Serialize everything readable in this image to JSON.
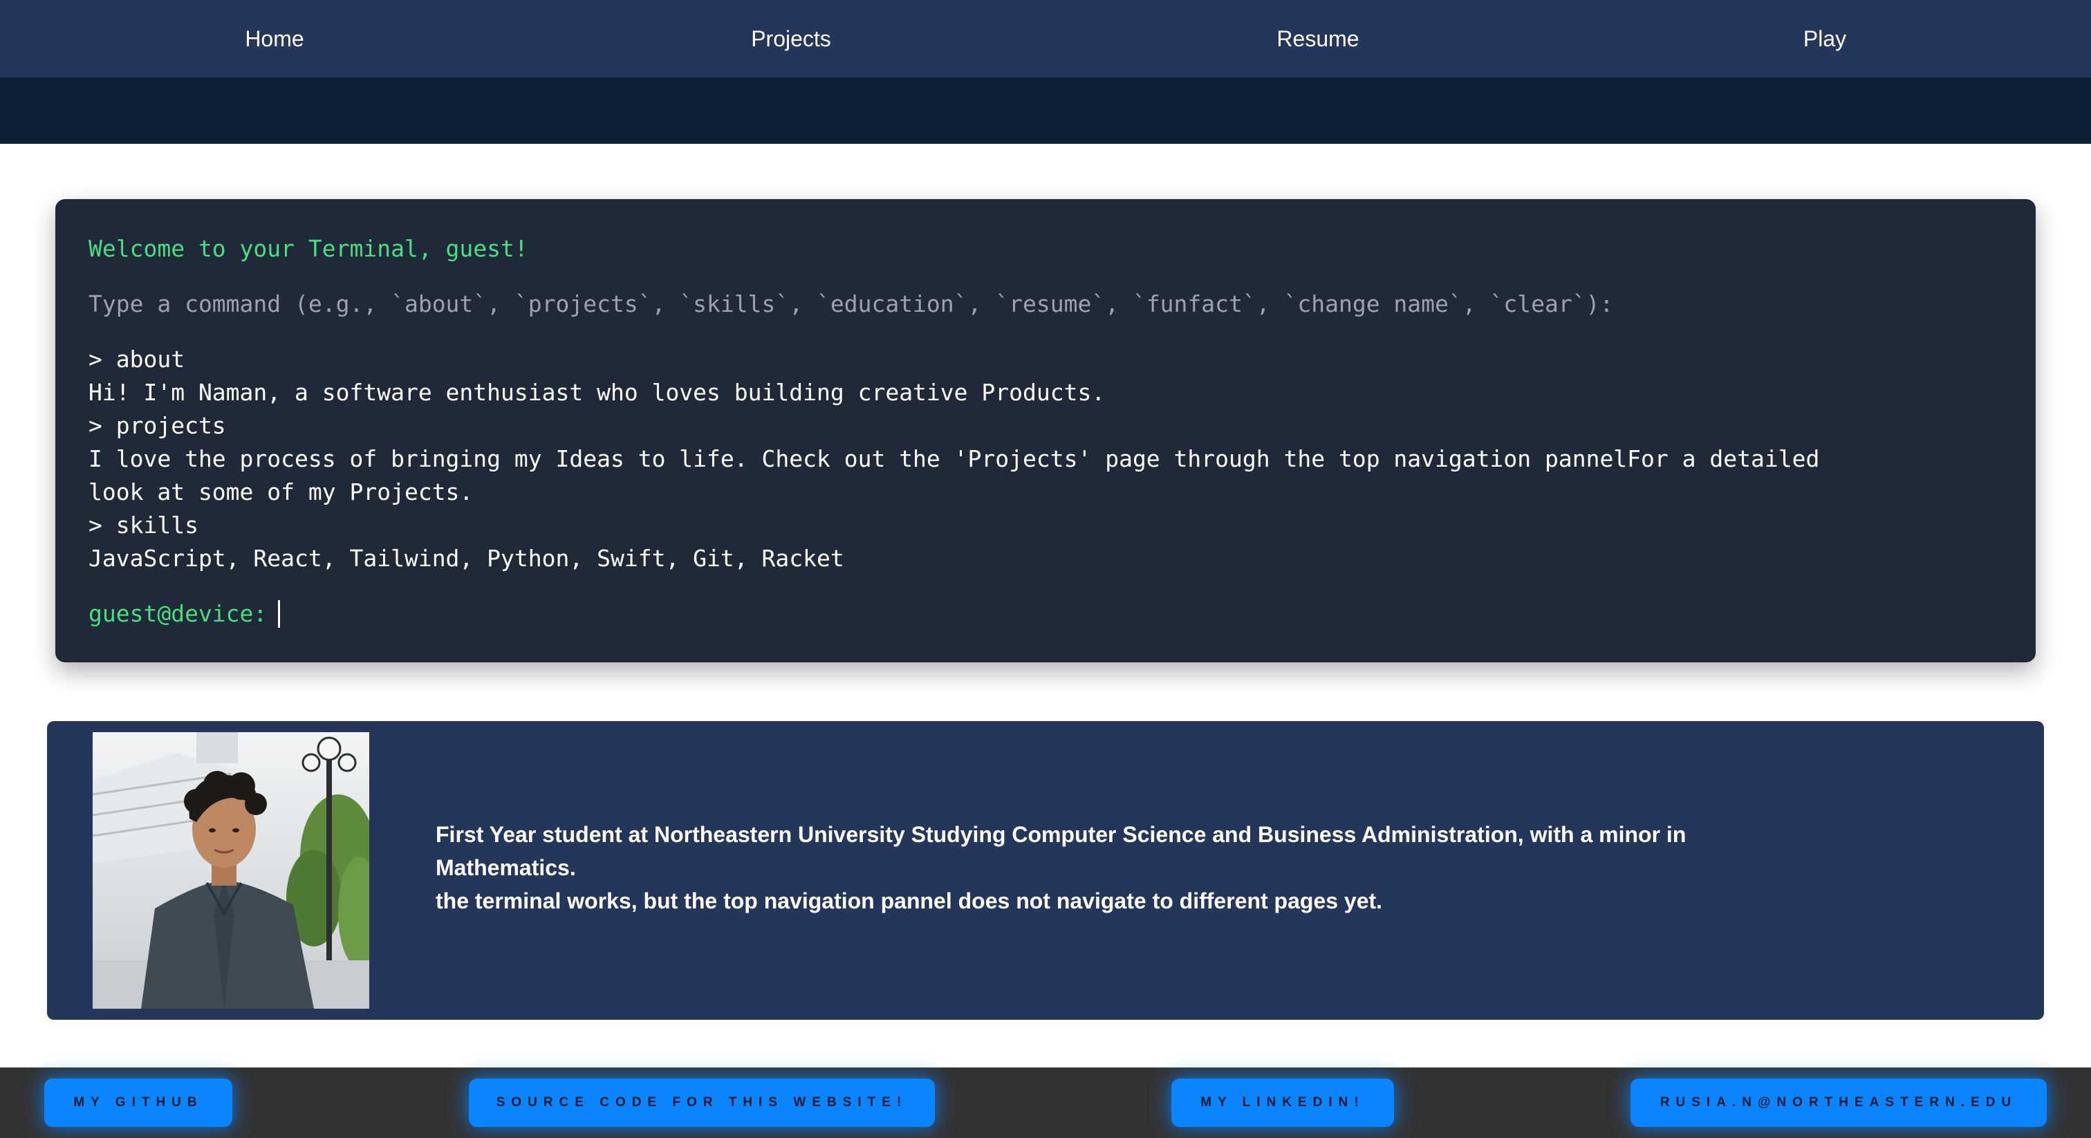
{
  "nav": {
    "items": [
      {
        "label": "Home"
      },
      {
        "label": "Projects"
      },
      {
        "label": "Resume"
      },
      {
        "label": "Play"
      }
    ]
  },
  "terminal": {
    "welcome": "Welcome to your Terminal, guest!",
    "hint": "Type a command (e.g., `about`, `projects`, `skills`, `education`, `resume`, `funfact`, `change name`, `clear`):",
    "history": [
      "> about",
      "Hi! I'm Naman, a software enthusiast who loves building creative Products.",
      "> projects",
      "I love the process of bringing my Ideas to life. Check out the 'Projects' page through the top navigation pannelFor a detailed look at some of my Projects.",
      "> skills",
      "JavaScript, React, Tailwind, Python, Swift, Git, Racket"
    ],
    "prompt": "guest@device:",
    "input_value": ""
  },
  "bio": {
    "line1": "First Year student at Northeastern University Studying Computer Science and Business Administration, with a minor in Mathematics.",
    "line2": "the terminal works, but the top navigation pannel does not navigate to different pages yet."
  },
  "footer": {
    "buttons": [
      {
        "label": "MY GITHUB"
      },
      {
        "label": "SOURCE CODE FOR THIS WEBSITE!"
      },
      {
        "label": "MY LINKEDIN!"
      },
      {
        "label": "RUSIA.N@NORTHEASTERN.EDU"
      }
    ]
  },
  "colors": {
    "nav_bg": "#243659",
    "nav_band": "#0d1f35",
    "terminal_bg": "#1f2937",
    "terminal_green": "#4ade80",
    "terminal_hint": "#9ca3af",
    "button_blue": "#0a84ff",
    "footer_bg": "#333333"
  }
}
